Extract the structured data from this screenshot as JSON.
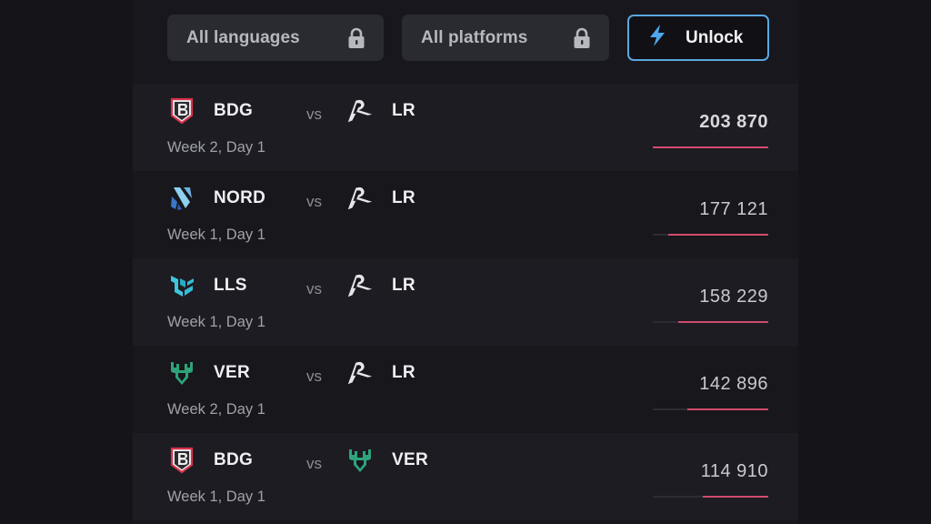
{
  "filters": {
    "languages_label": "All languages",
    "platforms_label": "All platforms",
    "lock_icon": "lock-icon",
    "unlock_label": "Unlock",
    "unlock_icon": "lightning-bolt-icon",
    "accent_color": "#5aa7e0"
  },
  "bar_color": "#d24a6e",
  "vs_label": "vs",
  "matches": [
    {
      "home": {
        "name": "BDG",
        "logo": "bdg-logo"
      },
      "away": {
        "name": "LR",
        "logo": "lr-logo"
      },
      "when": "Week 2, Day 1",
      "viewers": "203 870",
      "viewers_value": 203870,
      "fill_fraction": 1.0
    },
    {
      "home": {
        "name": "NORD",
        "logo": "nord-logo"
      },
      "away": {
        "name": "LR",
        "logo": "lr-logo"
      },
      "when": "Week 1, Day 1",
      "viewers": "177 121",
      "viewers_value": 177121,
      "fill_fraction": 0.869
    },
    {
      "home": {
        "name": "LLS",
        "logo": "lls-logo"
      },
      "away": {
        "name": "LR",
        "logo": "lr-logo"
      },
      "when": "Week 1, Day 1",
      "viewers": "158 229",
      "viewers_value": 158229,
      "fill_fraction": 0.776
    },
    {
      "home": {
        "name": "VER",
        "logo": "ver-logo"
      },
      "away": {
        "name": "LR",
        "logo": "lr-logo"
      },
      "when": "Week 2, Day 1",
      "viewers": "142 896",
      "viewers_value": 142896,
      "fill_fraction": 0.701
    },
    {
      "home": {
        "name": "BDG",
        "logo": "bdg-logo"
      },
      "away": {
        "name": "VER",
        "logo": "ver-logo"
      },
      "when": "Week 1, Day 1",
      "viewers": "114 910",
      "viewers_value": 114910,
      "fill_fraction": 0.564
    }
  ]
}
